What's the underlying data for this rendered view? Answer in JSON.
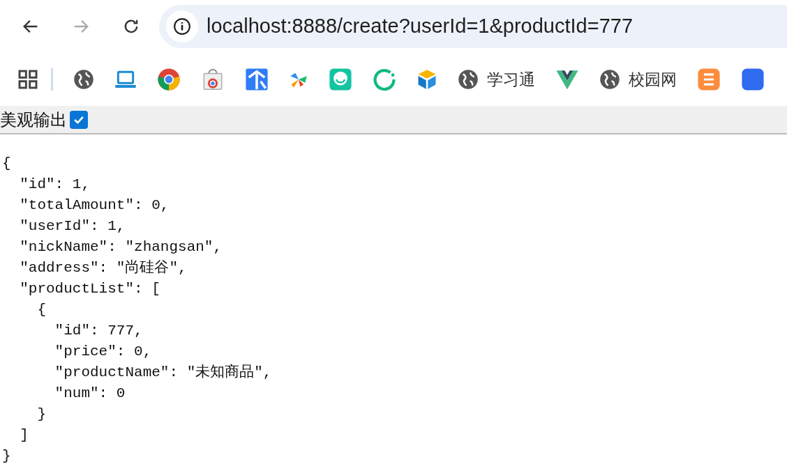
{
  "toolbar": {
    "url": "localhost:8888/create?userId=1&productId=777"
  },
  "bookmarks": [
    {
      "kind": "apps"
    },
    {
      "kind": "globe"
    },
    {
      "kind": "laptop"
    },
    {
      "kind": "chrome"
    },
    {
      "kind": "store"
    },
    {
      "kind": "tool"
    },
    {
      "kind": "pinwheel"
    },
    {
      "kind": "face"
    },
    {
      "kind": "ring"
    },
    {
      "kind": "cube"
    },
    {
      "kind": "globe",
      "label": "学习通"
    },
    {
      "kind": "vue"
    },
    {
      "kind": "globe",
      "label": "校园网"
    },
    {
      "kind": "orange"
    },
    {
      "kind": "blue"
    }
  ],
  "pretty_print": {
    "label": "美观输出",
    "checked": true
  },
  "json_lines": [
    "{",
    "  \"id\": 1,",
    "  \"totalAmount\": 0,",
    "  \"userId\": 1,",
    "  \"nickName\": \"zhangsan\",",
    "  \"address\": \"尚硅谷\",",
    "  \"productList\": [",
    "    {",
    "      \"id\": 777,",
    "      \"price\": 0,",
    "      \"productName\": \"未知商品\",",
    "      \"num\": 0",
    "    }",
    "  ]",
    "}"
  ]
}
